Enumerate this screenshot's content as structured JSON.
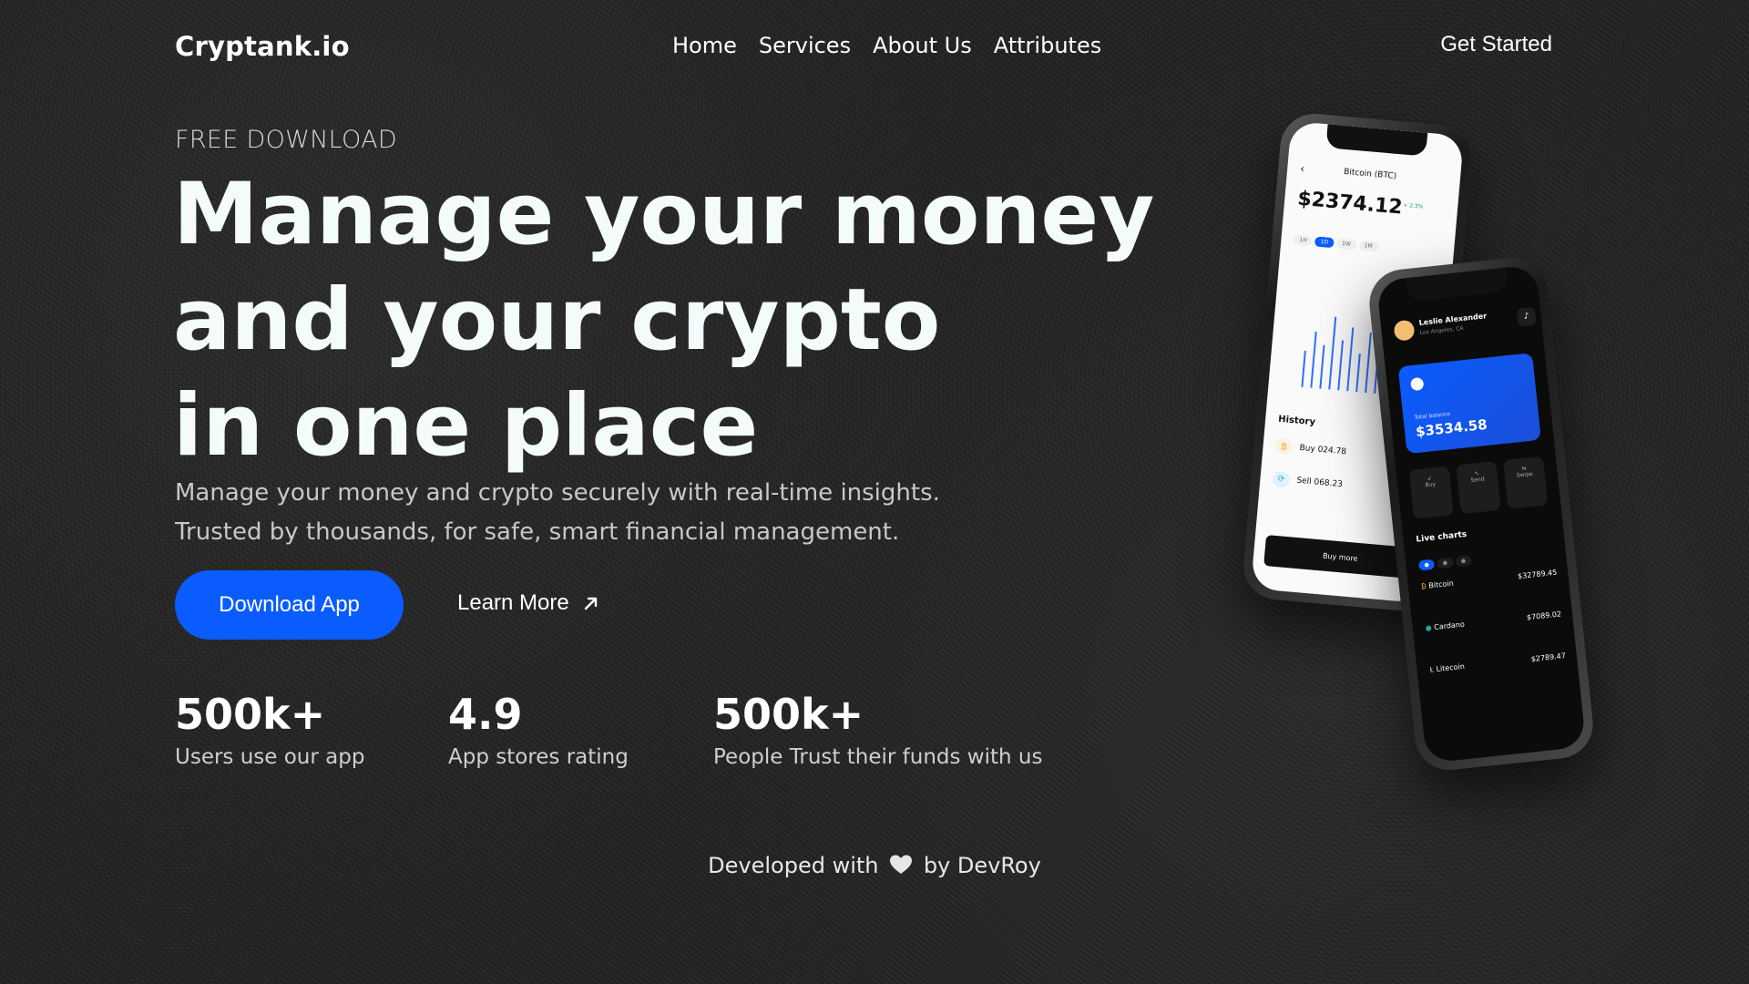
{
  "nav": {
    "logo": "Cryptank.io",
    "links": [
      "Home",
      "Services",
      "About Us",
      "Attributes"
    ],
    "cta": "Get Started"
  },
  "hero": {
    "eyebrow": "FREE DOWNLOAD",
    "headline": [
      "Manage your money",
      "and your crypto",
      "in one place"
    ],
    "subtitle": [
      "Manage your money and crypto securely with real-time insights.",
      "Trusted by thousands, for safe, smart financial management."
    ],
    "primary_button": "Download App",
    "secondary_button": "Learn More",
    "secondary_icon": "arrow-up-right-icon"
  },
  "stats": [
    {
      "value": "500k+",
      "label": "Users use our app"
    },
    {
      "value": "4.9",
      "label": "App stores rating"
    },
    {
      "value": "500k+",
      "label": "People Trust their funds with us"
    }
  ],
  "footer": {
    "prefix": "Developed with",
    "icon": "heart-icon",
    "suffix": "by DevRoy"
  },
  "phone_back": {
    "title": "Bitcoin (BTC)",
    "price": "$2374.12",
    "change": "+ 2.3%",
    "section": "History",
    "history": [
      {
        "label": "Buy 024.78"
      },
      {
        "label": "Sell 068.23"
      }
    ],
    "button": "Buy more"
  },
  "phone_front": {
    "user": "Leslie Alexander",
    "location": "Los Angeles, CA",
    "balance_label": "Total balance",
    "balance": "$3534.58",
    "actions": [
      "Buy",
      "Send",
      "Swipe"
    ],
    "section": "Live charts",
    "coins": [
      {
        "name": "Bitcoin",
        "price": "$32789.45"
      },
      {
        "name": "Cardano",
        "price": "$7089.02"
      },
      {
        "name": "Litecoin",
        "price": "$2789.47"
      }
    ]
  },
  "colors": {
    "background": "#242424",
    "accent": "#0a5cff",
    "text": "#ffffff",
    "muted": "#c8c8c8"
  }
}
